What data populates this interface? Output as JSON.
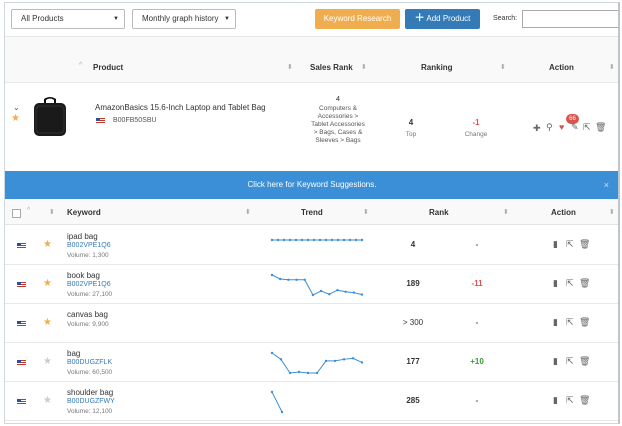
{
  "toolbar": {
    "product_filter": "All Products",
    "graph_history": "Monthly graph history",
    "keyword_research_label": "Keyword Research",
    "add_product_label": "Add Product",
    "search_label": "Search:",
    "search_value": ""
  },
  "product_table": {
    "headers": {
      "product": "Product",
      "sales_rank": "Sales Rank",
      "ranking": "Ranking",
      "action": "Action"
    },
    "row": {
      "title": "AmazonBasics 15.6-Inch Laptop and Tablet Bag",
      "asin": "B00FB50SBU",
      "sales_rank_number": "4",
      "sales_rank_categories": [
        "Computers &",
        "Accessories >",
        "Tablet Accessories",
        "> Bags, Cases &",
        "Sleeves > Bags"
      ],
      "top_value": "4",
      "top_label": "Top",
      "change_value": "-1",
      "change_label": "Change",
      "badge_count": "66",
      "starred": true
    }
  },
  "suggestion_bar": {
    "text": "Click here for Keyword Suggestions.",
    "close": "×"
  },
  "keyword_table": {
    "headers": {
      "keyword": "Keyword",
      "trend": "Trend",
      "rank": "Rank",
      "action": "Action"
    },
    "rows": [
      {
        "keyword": "ipad bag",
        "asin": "B002VPE1Q6",
        "volume": "Volume: 1,300",
        "rank": "4",
        "change": "-",
        "starred": true,
        "trend": [
          4,
          4,
          4,
          4,
          4,
          4,
          4,
          4,
          4,
          4,
          4,
          4,
          4,
          4,
          4,
          4
        ]
      },
      {
        "keyword": "book bag",
        "asin": "B002VPE1Q6",
        "volume": "Volume: 27,100",
        "rank": "189",
        "change": "-11",
        "starred": true,
        "trend": [
          150,
          160,
          162,
          162,
          162,
          200,
          190,
          198,
          188,
          192,
          194,
          199
        ]
      },
      {
        "keyword": "canvas bag",
        "asin": "",
        "volume": "Volume: 9,900",
        "rank": "> 300",
        "change": "-",
        "starred": true,
        "trend": []
      },
      {
        "keyword": "bag",
        "asin": "B00DUGZFLK",
        "volume": "Volume: 60,500",
        "rank": "177",
        "change": "+10",
        "starred": false,
        "trend": [
          160,
          172,
          198,
          196,
          198,
          198,
          175,
          175,
          172,
          170,
          178
        ]
      },
      {
        "keyword": "shoulder bag",
        "asin": "B00DUGZFWY",
        "volume": "Volume: 12,100",
        "rank": "285",
        "change": "-",
        "starred": false,
        "trend": [
          240,
          300
        ]
      }
    ]
  },
  "colors": {
    "orange": "#f0ad4e",
    "blue": "#337ab7",
    "banner": "#3b8fd6",
    "negative": "#d9534f",
    "positive": "#3c9a3c",
    "trend_line": "#3b8fd6"
  },
  "icons": {
    "chevron": "chevron-down-icon",
    "star": "star-icon",
    "flag": "us-flag-icon",
    "add": "plus-icon",
    "search": "magnifier-icon",
    "heart": "heart-icon",
    "edit": "pencil-icon",
    "external": "external-link-icon",
    "trash": "trash-icon",
    "chart": "bar-chart-icon"
  }
}
